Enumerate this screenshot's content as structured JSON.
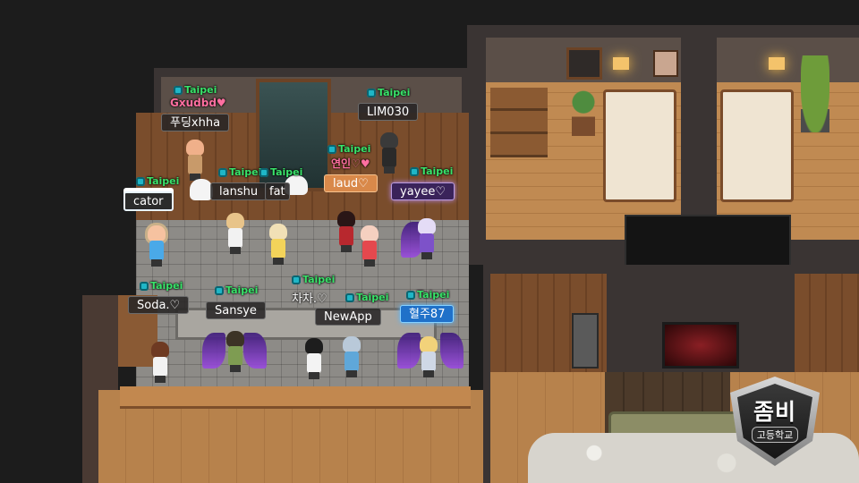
{
  "scene": {
    "room_name": "Taipei",
    "colors": {
      "nickname_tag": "#39e36a",
      "heart_name": "#ff6fa0",
      "plate_bg": "#28262699"
    }
  },
  "players": [
    {
      "id": "p1",
      "server": "Taipei",
      "guild": "Gxudbd♥",
      "name": "푸딩xhha",
      "plate_style": "default"
    },
    {
      "id": "p2",
      "server": "Taipei",
      "guild": "",
      "name": "LIM030",
      "plate_style": "default"
    },
    {
      "id": "p3",
      "server": "Taipei",
      "guild": "연인♡♥",
      "name": "laud♡",
      "plate_style": "gold"
    },
    {
      "id": "p4",
      "server": "Taipei",
      "guild": "",
      "name": "yayee♡",
      "plate_style": "purple"
    },
    {
      "id": "p5",
      "server": "Taipei",
      "guild": "",
      "name": "cator",
      "plate_style": "snow"
    },
    {
      "id": "p6",
      "server": "Taipei",
      "guild": "",
      "name": "lanshu",
      "plate_style": "default"
    },
    {
      "id": "p7",
      "server": "Taipei",
      "guild": "",
      "name": "fat",
      "plate_style": "default"
    },
    {
      "id": "p8",
      "server": "Taipei",
      "guild": "",
      "name": "Soda.♡",
      "plate_style": "default"
    },
    {
      "id": "p9",
      "server": "Taipei",
      "guild": "",
      "name": "Sansye",
      "plate_style": "default"
    },
    {
      "id": "p10",
      "server": "Taipei",
      "guild": "",
      "name": "차차.♡",
      "plate_style": "default"
    },
    {
      "id": "p11",
      "server": "Taipei",
      "guild": "",
      "name": "NewApp",
      "plate_style": "default"
    },
    {
      "id": "p12",
      "server": "Taipei",
      "guild": "",
      "name": "혈주87",
      "plate_style": "blue"
    }
  ],
  "logo": {
    "title": "좀비",
    "subtitle": "고등학교"
  }
}
